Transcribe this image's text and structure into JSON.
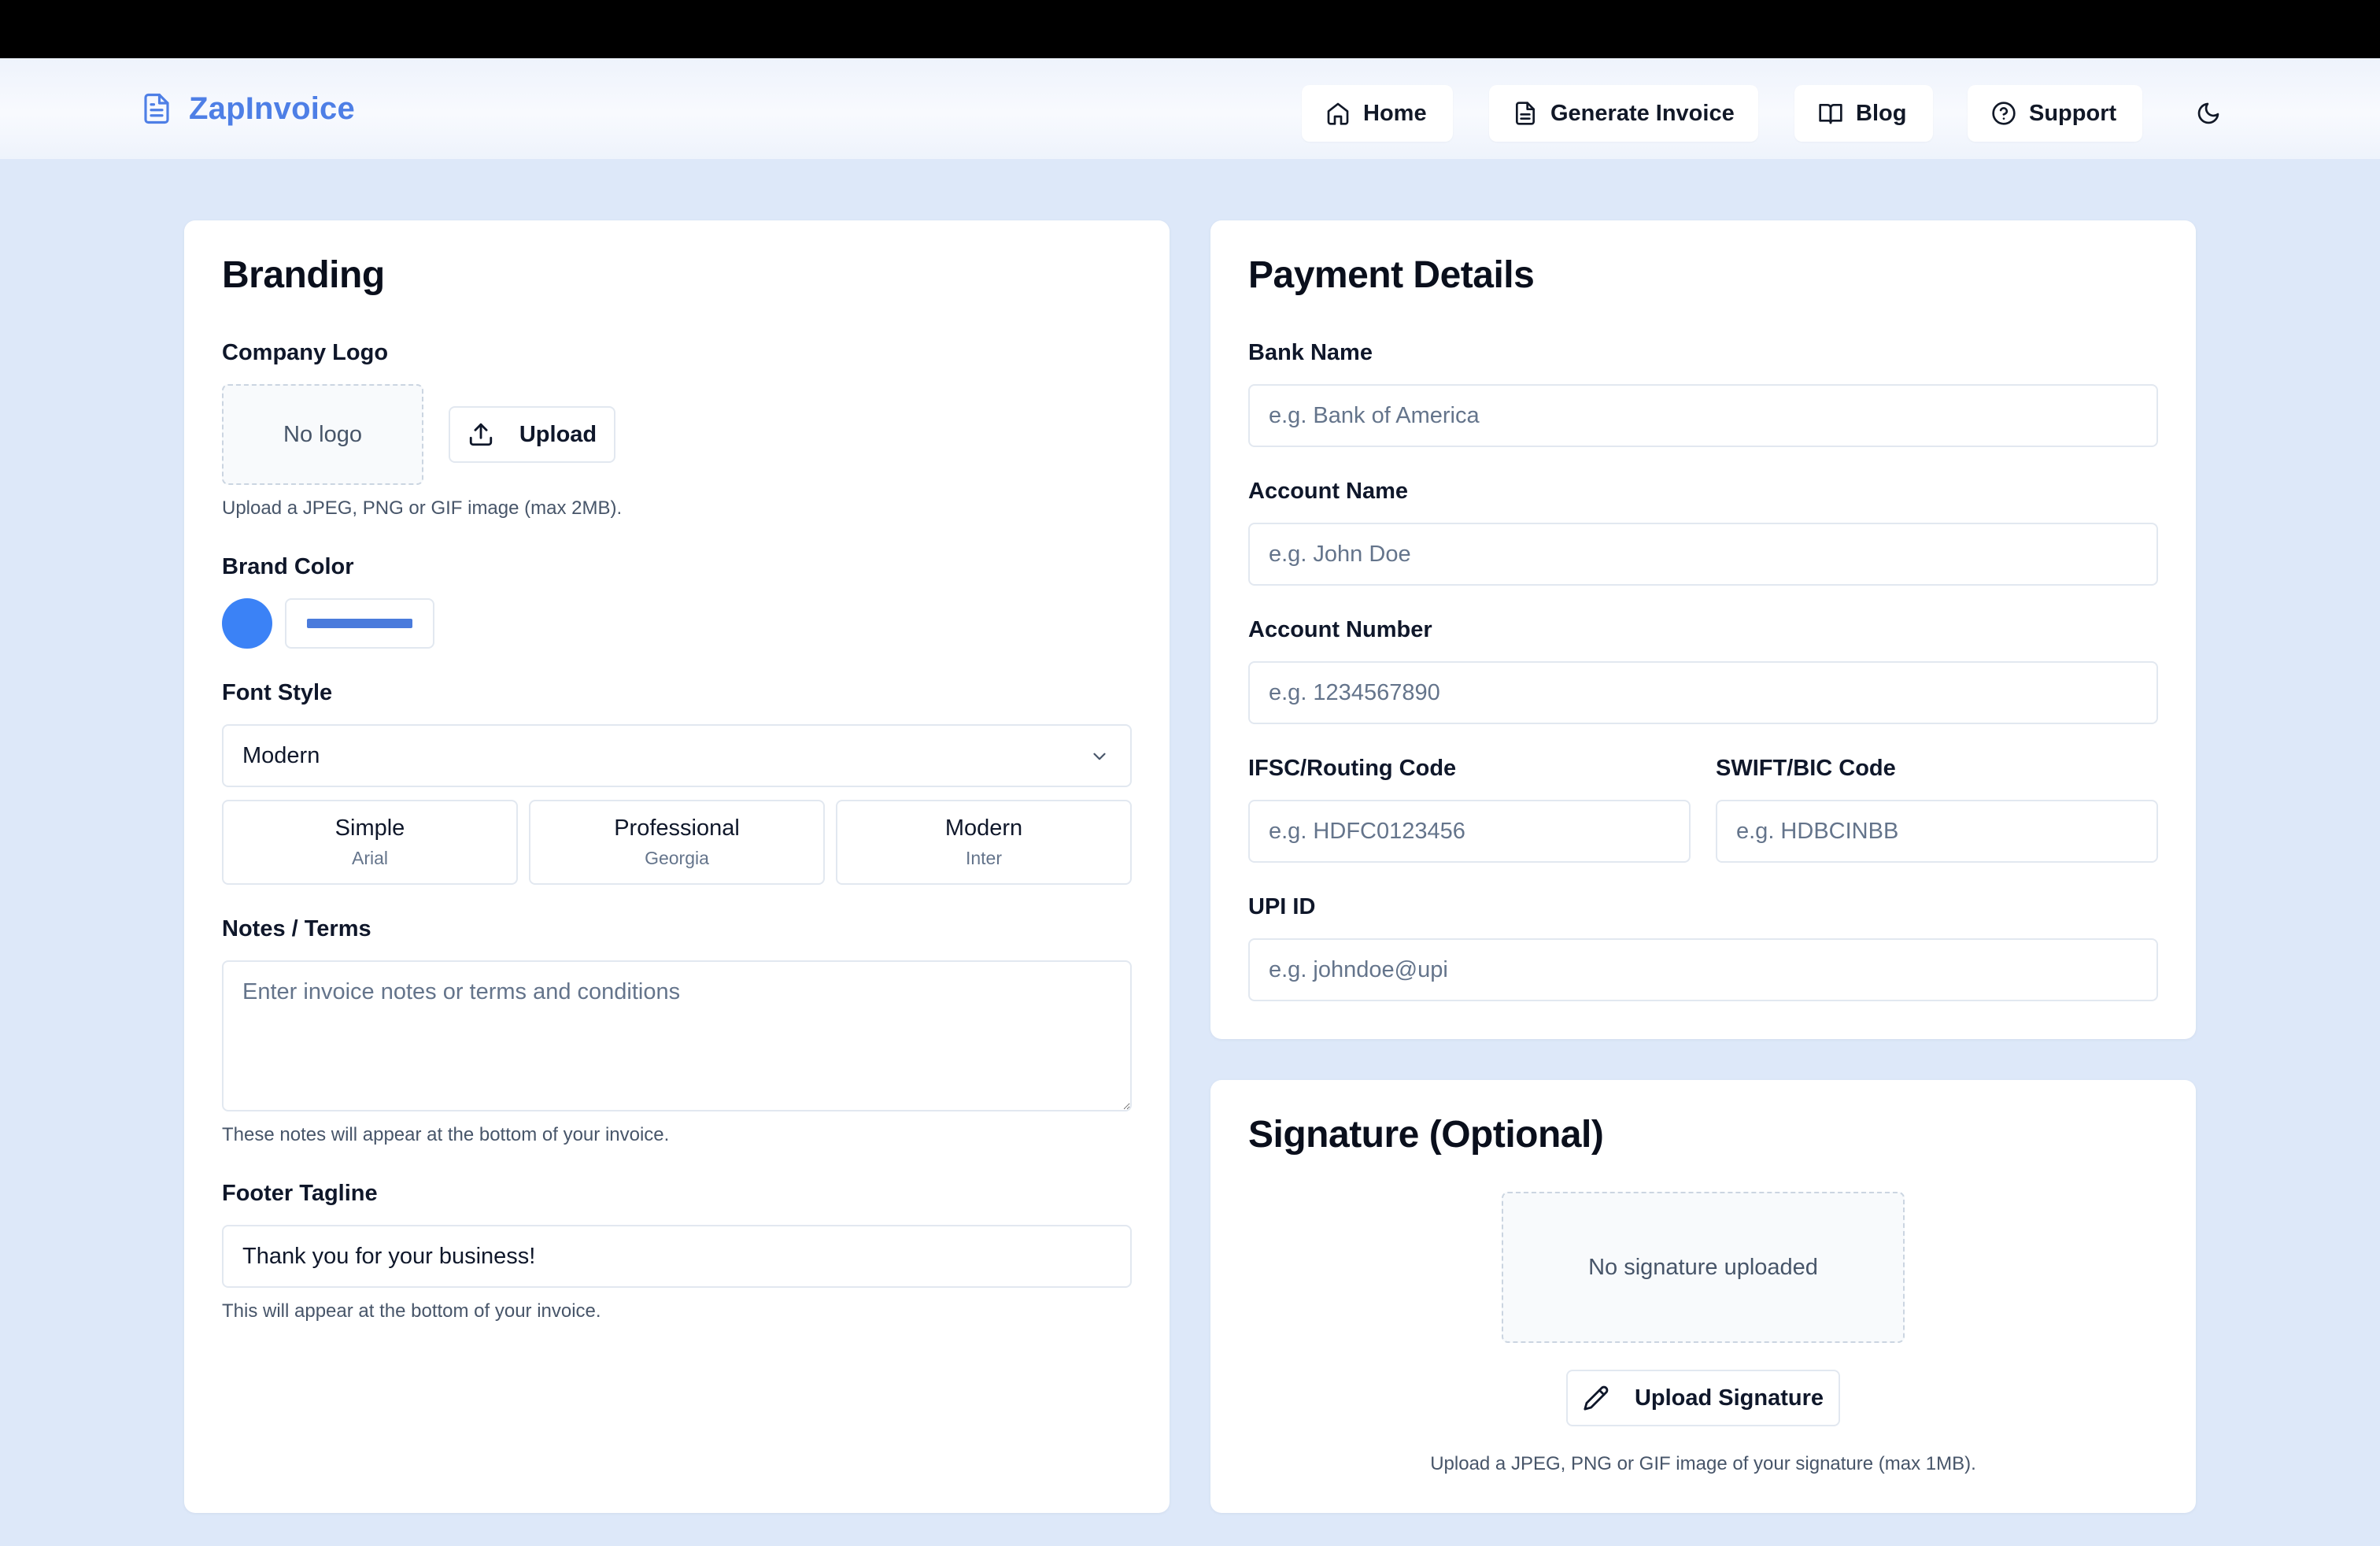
{
  "app": {
    "name": "ZapInvoice"
  },
  "nav": {
    "items": [
      {
        "label": "Home",
        "icon": "home-icon"
      },
      {
        "label": "Generate Invoice",
        "icon": "document-icon"
      },
      {
        "label": "Blog",
        "icon": "book-icon"
      },
      {
        "label": "Support",
        "icon": "help-circle-icon"
      }
    ],
    "theme_toggle_icon": "moon-icon"
  },
  "branding": {
    "title": "Branding",
    "logo": {
      "label": "Company Logo",
      "placeholder": "No logo",
      "upload_label": "Upload",
      "help": "Upload a JPEG, PNG or GIF image (max 2MB)."
    },
    "color": {
      "label": "Brand Color",
      "value": "#3b82f6"
    },
    "font": {
      "label": "Font Style",
      "selected": "Modern",
      "options": [
        {
          "name": "Simple",
          "font": "Arial"
        },
        {
          "name": "Professional",
          "font": "Georgia"
        },
        {
          "name": "Modern",
          "font": "Inter"
        }
      ]
    },
    "notes": {
      "label": "Notes / Terms",
      "placeholder": "Enter invoice notes or terms and conditions",
      "help": "These notes will appear at the bottom of your invoice."
    },
    "footer": {
      "label": "Footer Tagline",
      "value": "Thank you for your business!",
      "help": "This will appear at the bottom of your invoice."
    }
  },
  "payment": {
    "title": "Payment Details",
    "bank_name": {
      "label": "Bank Name",
      "placeholder": "e.g. Bank of America"
    },
    "account_name": {
      "label": "Account Name",
      "placeholder": "e.g. John Doe"
    },
    "account_number": {
      "label": "Account Number",
      "placeholder": "e.g. 1234567890"
    },
    "ifsc": {
      "label": "IFSC/Routing Code",
      "placeholder": "e.g. HDFC0123456"
    },
    "swift": {
      "label": "SWIFT/BIC Code",
      "placeholder": "e.g. HDBCINBB"
    },
    "upi": {
      "label": "UPI ID",
      "placeholder": "e.g. johndoe@upi"
    }
  },
  "signature": {
    "title": "Signature (Optional)",
    "placeholder": "No signature uploaded",
    "upload_label": "Upload Signature",
    "help": "Upload a JPEG, PNG or GIF image of your signature (max 1MB)."
  },
  "colors": {
    "accent": "#4e7fe6",
    "background": "#dde8f9",
    "brand_swatch": "#3b82f6"
  }
}
